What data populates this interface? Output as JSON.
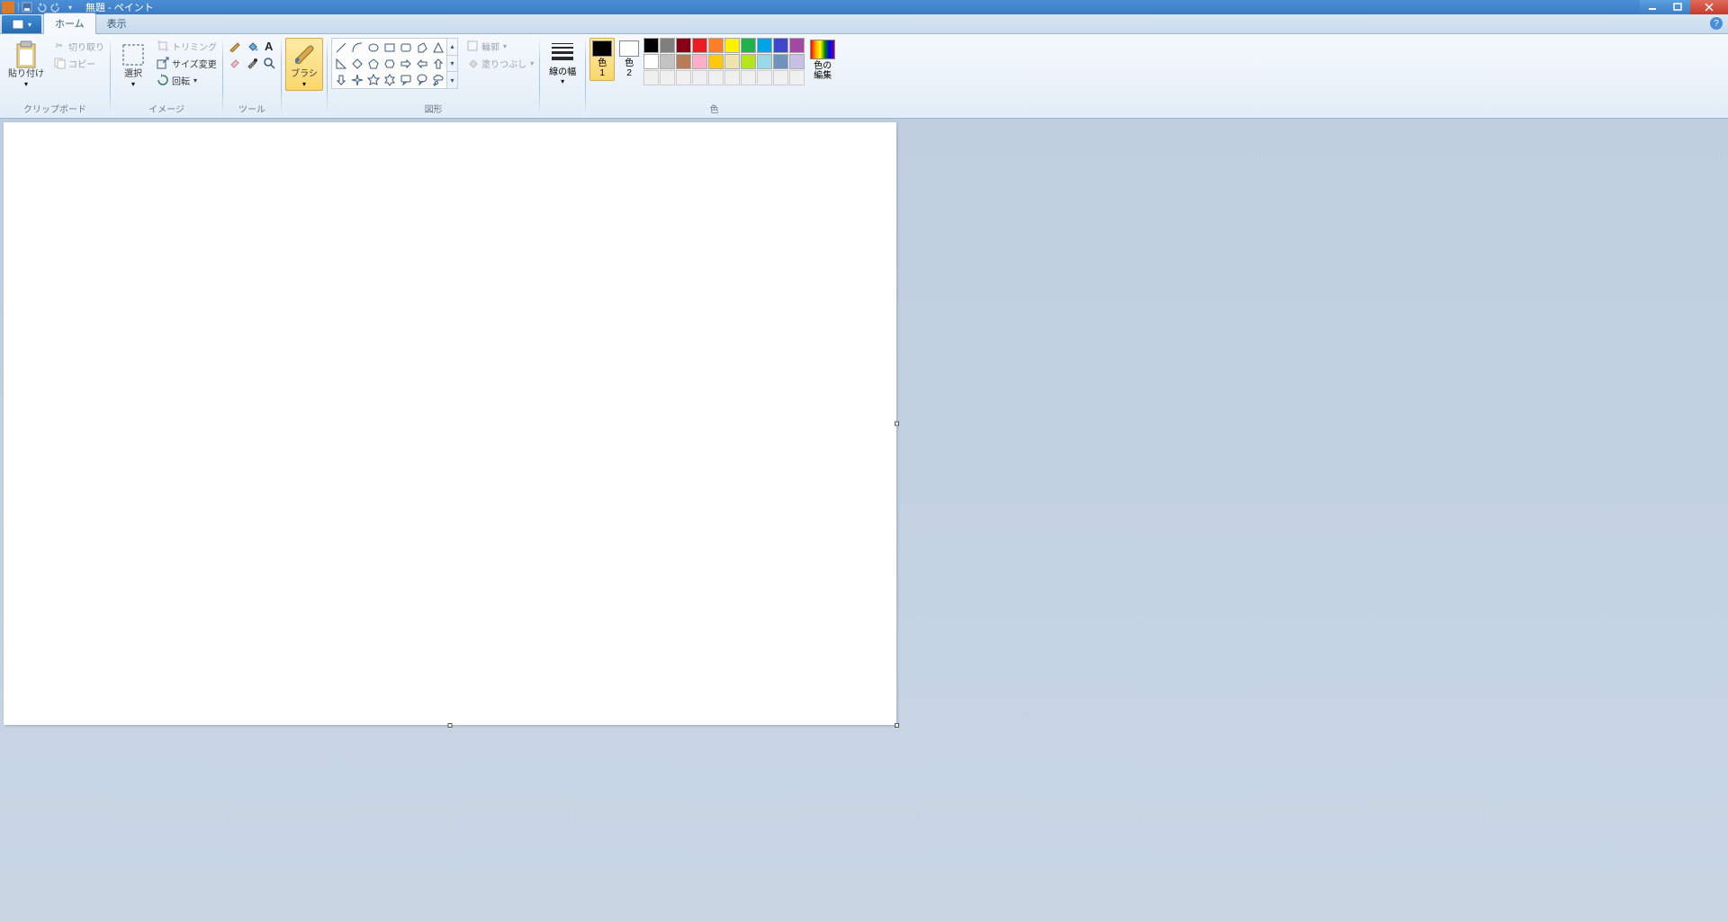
{
  "window": {
    "title": "無題 - ペイント"
  },
  "tabs": {
    "file": "",
    "home": "ホーム",
    "view": "表示"
  },
  "groups": {
    "clipboard": {
      "label": "クリップボード",
      "paste": "貼り付け",
      "cut": "切り取り",
      "copy": "コピー"
    },
    "image": {
      "label": "イメージ",
      "select": "選択",
      "crop": "トリミング",
      "resize": "サイズ変更",
      "rotate": "回転"
    },
    "tools": {
      "label": "ツール"
    },
    "brush": {
      "label": "ブラシ"
    },
    "shapes": {
      "label": "図形",
      "outline": "輪郭",
      "fill": "塗りつぶし"
    },
    "stroke": {
      "label": "線の幅"
    },
    "colors": {
      "label": "色",
      "color1": "色\n1",
      "color2": "色\n2",
      "edit": "色の\n編集",
      "c1_value": "#000000",
      "c2_value": "#ffffff"
    }
  },
  "palette_row1": [
    "#000000",
    "#7f7f7f",
    "#880015",
    "#ed1c24",
    "#ff7f27",
    "#fff200",
    "#22b14c",
    "#00a2e8",
    "#3f48cc",
    "#a349a4"
  ],
  "palette_row2": [
    "#ffffff",
    "#c3c3c3",
    "#b97a57",
    "#ffaec9",
    "#ffc90e",
    "#efe4b0",
    "#b5e61d",
    "#99d9ea",
    "#7092be",
    "#c8bfe7"
  ]
}
